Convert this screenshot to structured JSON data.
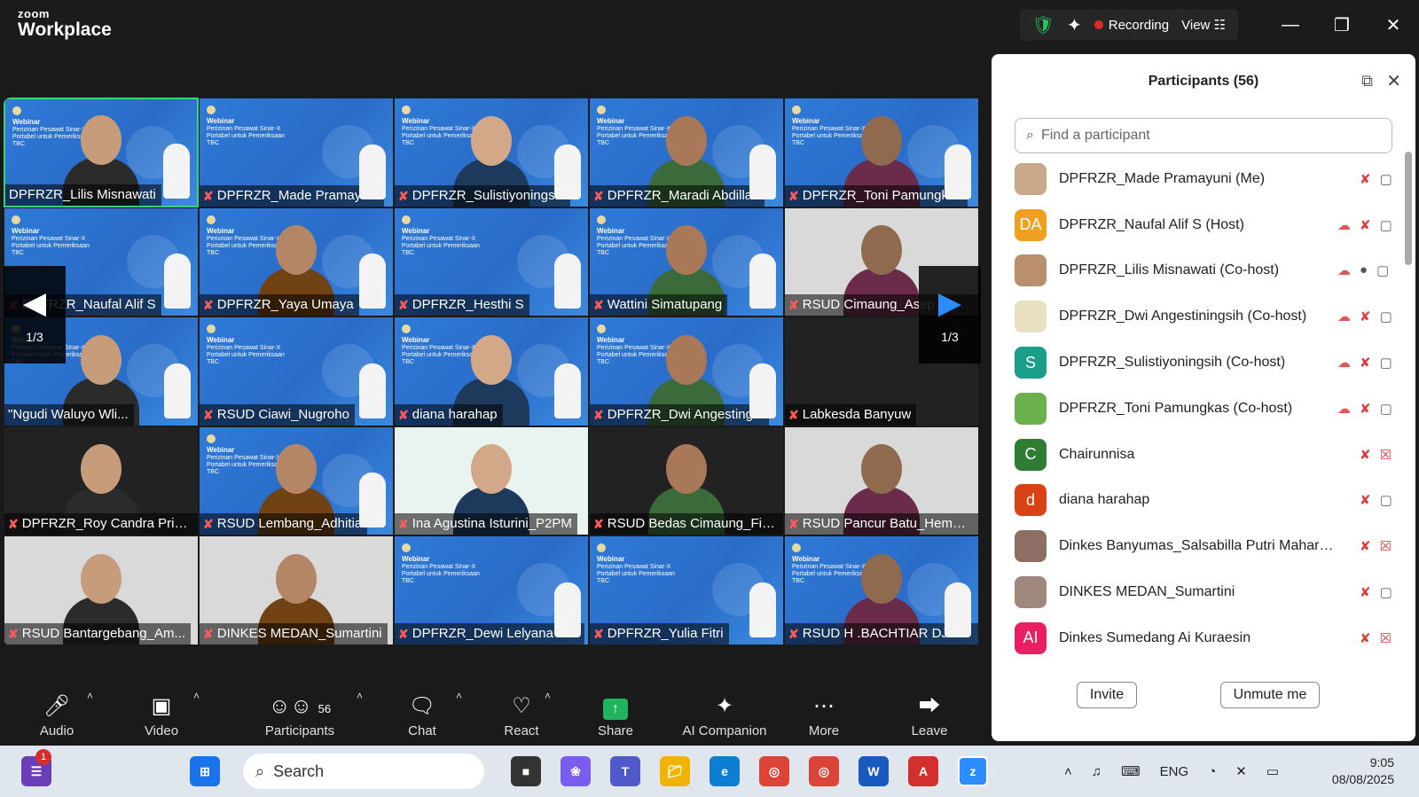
{
  "app": {
    "logo_top": "zoom",
    "logo_bottom": "Workplace"
  },
  "topbar": {
    "recording": "Recording",
    "view": "View"
  },
  "gallery": {
    "page_indicator": "1/3",
    "tiles": [
      {
        "name": "DPFRZR_Lilis Misnawati",
        "muted": false,
        "kind": "cam-slide",
        "active": true
      },
      {
        "name": "DPFRZR_Made Pramayuni",
        "muted": true,
        "kind": "slide"
      },
      {
        "name": "DPFRZR_Sulistiyoningsih",
        "muted": true,
        "kind": "cam-slide"
      },
      {
        "name": "DPFRZR_Maradi Abdillah",
        "muted": true,
        "kind": "cam-slide"
      },
      {
        "name": "DPFRZR_Toni Pamungkas",
        "muted": true,
        "kind": "cam-slide"
      },
      {
        "name": "DPFRZR_Naufal Alif S",
        "muted": true,
        "kind": "slide"
      },
      {
        "name": "DPFRZR_Yaya Umaya",
        "muted": true,
        "kind": "cam-slide"
      },
      {
        "name": "DPFRZR_Hesthi S",
        "muted": true,
        "kind": "slide"
      },
      {
        "name": "Wattini Simatupang",
        "muted": true,
        "kind": "cam-slide"
      },
      {
        "name": "RSUD Cimaung_Asep Goz...",
        "muted": true,
        "kind": "cam"
      },
      {
        "name": "\"Ngudi Waluyo Wli...",
        "muted": false,
        "kind": "cam-slide"
      },
      {
        "name": "RSUD Ciawi_Nugroho",
        "muted": true,
        "kind": "slide"
      },
      {
        "name": "diana harahap",
        "muted": true,
        "kind": "cam-slide"
      },
      {
        "name": "DPFRZR_Dwi Angesting...",
        "muted": true,
        "kind": "cam-slide"
      },
      {
        "name": "Labkesda Banyuw",
        "muted": true,
        "kind": "dark"
      },
      {
        "name": "DPFRZR_Roy Candra Prim...",
        "muted": true,
        "kind": "cam-dark"
      },
      {
        "name": "RSUD Lembang_Adhitia",
        "muted": true,
        "kind": "cam-slide"
      },
      {
        "name": "Ina Agustina Isturini_P2PM",
        "muted": true,
        "kind": "cam-light"
      },
      {
        "name": "RSUD Bedas Cimaung_Fik...",
        "muted": true,
        "kind": "cam-dark"
      },
      {
        "name": "RSUD Pancur Batu_Hema ...",
        "muted": true,
        "kind": "cam"
      },
      {
        "name": "RSUD Bantargebang_Am...",
        "muted": true,
        "kind": "cam"
      },
      {
        "name": "DINKES MEDAN_Sumartini",
        "muted": true,
        "kind": "cam"
      },
      {
        "name": "DPFRZR_Dewi Lelyana M...",
        "muted": true,
        "kind": "slide"
      },
      {
        "name": "DPFRZR_Yulia Fitri",
        "muted": true,
        "kind": "slide"
      },
      {
        "name": "RSUD H .BACHTIAR DJAF...",
        "muted": true,
        "kind": "cam-slide"
      }
    ],
    "slide_title": "Webinar",
    "slide_body": "Perizinan Pesawat Sinar-X Portabel untuk Pemeriksaan TBC"
  },
  "toolbar": {
    "audio": "Audio",
    "video": "Video",
    "participants": "Participants",
    "participants_count": "56",
    "chat": "Chat",
    "react": "React",
    "share": "Share",
    "ai_companion": "AI Companion",
    "more": "More",
    "leave": "Leave"
  },
  "panel": {
    "title": "Participants (56)",
    "search_placeholder": "Find a participant",
    "participants": [
      {
        "name": "DPFRZR_Made Pramayuni (Me)",
        "avatar": "",
        "color": "#c9a98a",
        "cloud": false,
        "mic": "off",
        "video": "on"
      },
      {
        "name": "DPFRZR_Naufal Alif S (Host)",
        "avatar": "DA",
        "color": "#f0a020",
        "cloud": true,
        "mic": "off",
        "video": "on"
      },
      {
        "name": "DPFRZR_Lilis Misnawati (Co-host)",
        "avatar": "",
        "color": "#b98f6e",
        "cloud": true,
        "mic": "on",
        "video": "on"
      },
      {
        "name": "DPFRZR_Dwi Angestiningsih (Co-host)",
        "avatar": "",
        "color": "#e8e0c0",
        "cloud": true,
        "mic": "off",
        "video": "on"
      },
      {
        "name": "DPFRZR_Sulistiyoningsih (Co-host)",
        "avatar": "S",
        "color": "#1a9e8a",
        "cloud": true,
        "mic": "off",
        "video": "on"
      },
      {
        "name": "DPFRZR_Toni Pamungkas (Co-host)",
        "avatar": "",
        "color": "#6ab04c",
        "cloud": true,
        "mic": "off",
        "video": "on"
      },
      {
        "name": "Chairunnisa",
        "avatar": "C",
        "color": "#2e7d32",
        "cloud": false,
        "mic": "off",
        "video": "off"
      },
      {
        "name": "diana harahap",
        "avatar": "d",
        "color": "#d84315",
        "cloud": false,
        "mic": "off",
        "video": "on"
      },
      {
        "name": "Dinkes Banyumas_Salsabilla Putri Mahara...",
        "avatar": "",
        "color": "#8d6e63",
        "cloud": false,
        "mic": "off",
        "video": "off"
      },
      {
        "name": "DINKES MEDAN_Sumartini",
        "avatar": "",
        "color": "#a1887f",
        "cloud": false,
        "mic": "off",
        "video": "on"
      },
      {
        "name": "Dinkes Sumedang Ai Kuraesin",
        "avatar": "AI",
        "color": "#e91e63",
        "cloud": false,
        "mic": "off",
        "video": "off"
      }
    ],
    "invite": "Invite",
    "unmute_me": "Unmute me"
  },
  "taskbar": {
    "search": "Search",
    "lang": "ENG",
    "time": "9:05",
    "date": "08/08/2025",
    "badge": "1"
  }
}
